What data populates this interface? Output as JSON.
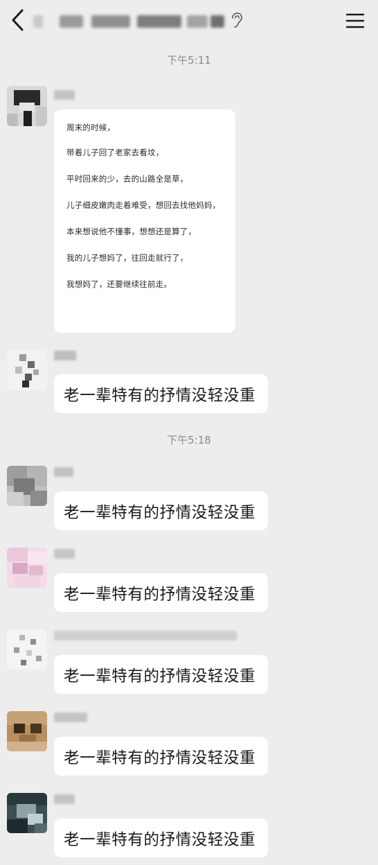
{
  "header": {
    "title": "群聊",
    "back_icon": "chevron-left-icon",
    "ear_icon": "ear-icon",
    "menu_icon": "hamburger-menu-icon"
  },
  "timestamps": [
    "下午5:11",
    "下午5:18"
  ],
  "poem_message": {
    "lines": [
      "周末的时候，",
      "带着儿子回了老家去看坟，",
      "平时回来的少，去的山路全是草，",
      "儿子细皮嫩肉走着难受，想回去找他妈妈，",
      "本来想说他不懂事，想想还是算了，",
      "我的儿子想妈了，往回走就行了，",
      "我想妈了，还要继续往前走。"
    ]
  },
  "reply_text": "老一辈特有的抒情没轻没重",
  "colors": {
    "background": "#ededed",
    "bubble": "#ffffff",
    "timestamp": "#8a8a8a"
  }
}
